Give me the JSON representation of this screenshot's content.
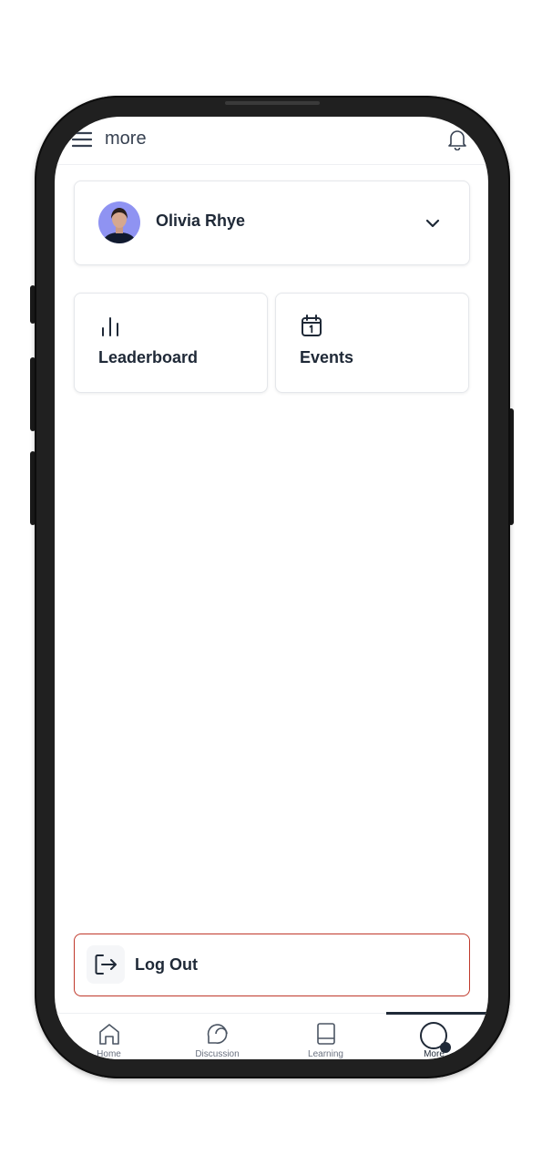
{
  "header": {
    "title": "more",
    "menu_icon": "hamburger-icon",
    "bell_icon": "bell-icon"
  },
  "profile": {
    "name": "Olivia Rhye",
    "avatar": "avatar-photo",
    "chevron_icon": "chevron-down-icon"
  },
  "tiles": [
    {
      "label": "Leaderboard",
      "icon": "bar-chart-icon"
    },
    {
      "label": "Events",
      "icon": "calendar-icon"
    }
  ],
  "logout": {
    "label": "Log Out",
    "icon": "logout-icon",
    "border_color": "#c0392b"
  },
  "bottom_nav": {
    "items": [
      {
        "label": "Home",
        "icon": "home-icon"
      },
      {
        "label": "Discussion",
        "icon": "chat-bubble-icon"
      },
      {
        "label": "Learning",
        "icon": "book-icon"
      },
      {
        "label": "More",
        "icon": "avatar-icon",
        "active": true
      }
    ]
  },
  "colors": {
    "text": "#1f2937",
    "muted": "#6b7280",
    "avatar_bg": "#8b8ff0",
    "frame": "#202020"
  }
}
